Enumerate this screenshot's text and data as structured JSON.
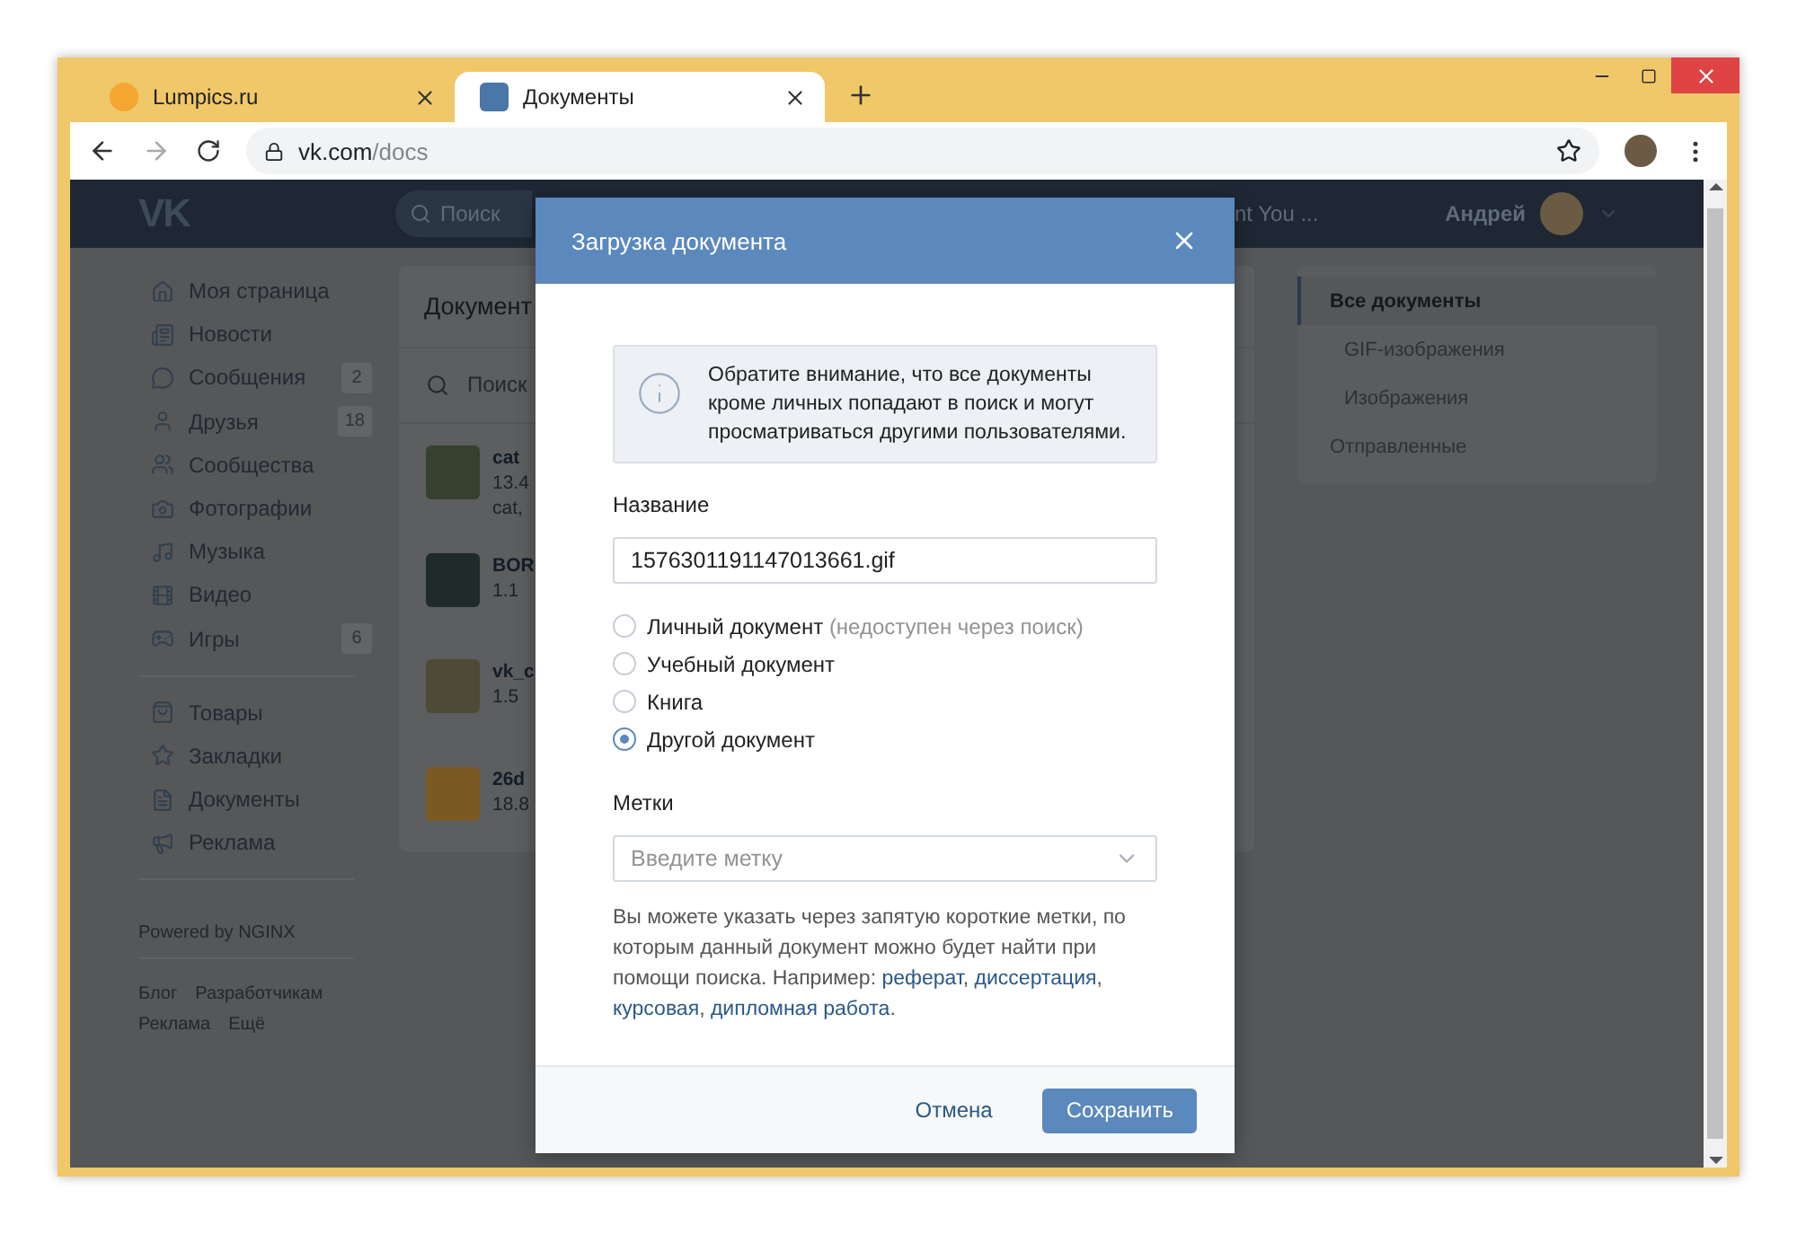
{
  "browser": {
    "tabs": [
      {
        "title": "Lumpics.ru",
        "selected": false,
        "kind": "lumpics"
      },
      {
        "title": "Документы",
        "selected": true,
        "kind": "vk"
      }
    ],
    "url_host": "vk.com",
    "url_path": "/docs"
  },
  "header": {
    "logo": "VK",
    "search_placeholder": "Поиск",
    "now_playing": "nt You ...",
    "user": "Андрей"
  },
  "nav": {
    "groups": [
      [
        {
          "label": "Моя страница"
        },
        {
          "label": "Новости"
        },
        {
          "label": "Сообщения",
          "counter": "2"
        },
        {
          "label": "Друзья",
          "counter": "18"
        },
        {
          "label": "Сообщества"
        },
        {
          "label": "Фотографии"
        },
        {
          "label": "Музыка"
        },
        {
          "label": "Видео"
        },
        {
          "label": "Игры",
          "counter": "6"
        }
      ],
      [
        {
          "label": "Товары"
        },
        {
          "label": "Закладки"
        },
        {
          "label": "Документы"
        },
        {
          "label": "Реклама"
        }
      ]
    ],
    "powered": "Powered by NGINX",
    "footer_links": [
      [
        "Блог",
        "Разработчикам"
      ],
      [
        "Реклама",
        "Ещё"
      ]
    ]
  },
  "documents": {
    "title": "Документ",
    "search_placeholder": "Поиск",
    "rows": [
      {
        "name": "cat",
        "size": "13.4",
        "tags": "cat,"
      },
      {
        "name": "BOR",
        "size": "1.1"
      },
      {
        "name": "vk_c",
        "size": "1.5"
      },
      {
        "name": "26d",
        "size": "18.8"
      }
    ]
  },
  "filters": [
    {
      "label": "Все документы",
      "selected": true,
      "children": [
        {
          "label": "GIF-изображения",
          "selected": false
        },
        {
          "label": "Изображения",
          "selected": false
        }
      ]
    },
    {
      "label": "Отправленные",
      "selected": false
    }
  ],
  "modal": {
    "title": "Загрузка документа",
    "notice": "Обратите внимание, что все документы кроме личных попадают в поиск и могут просматриваться другими пользователями.",
    "name_label": "Название",
    "name_value": "1576301191147013661.gif",
    "doc_types": [
      {
        "label": "Личный документ",
        "note": "(недоступен через поиск)",
        "selected": false
      },
      {
        "label": "Учебный документ",
        "selected": false
      },
      {
        "label": "Книга",
        "selected": false
      },
      {
        "label": "Другой документ",
        "selected": true
      }
    ],
    "tags_label": "Метки",
    "tags_placeholder": "Введите метку",
    "help": [
      {
        "kind": "text",
        "text": "Вы можете указать через запятую короткие метки, по которым данный документ можно будет найти при помощи поиска. Например: "
      },
      {
        "kind": "link",
        "text": "реферат"
      },
      {
        "kind": "text",
        "text": ", "
      },
      {
        "kind": "link",
        "text": "диссертация"
      },
      {
        "kind": "text",
        "text": ", "
      },
      {
        "kind": "link",
        "text": "курсовая"
      },
      {
        "kind": "text",
        "text": ", "
      },
      {
        "kind": "link",
        "text": "дипломная работа"
      },
      {
        "kind": "text",
        "text": "."
      }
    ],
    "cancel": "Отмена",
    "save": "Сохранить"
  }
}
